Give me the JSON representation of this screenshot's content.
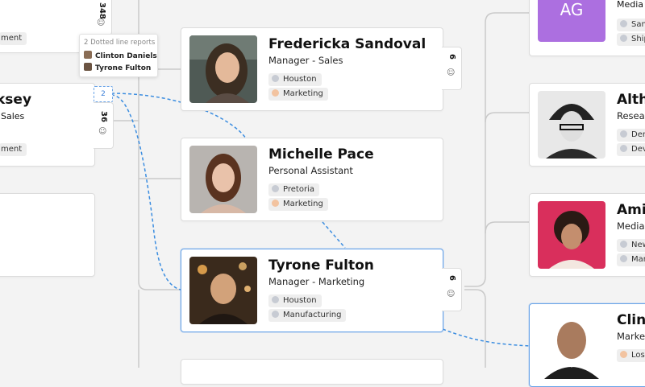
{
  "tooltip": {
    "header": "2 Dotted line reports",
    "rows": [
      "Clinton Daniels",
      "Tyrone Fulton"
    ]
  },
  "left_top": {
    "count": "348",
    "tag": "ment"
  },
  "left_mid": {
    "name": "ksey",
    "role": "Sales",
    "count": "36",
    "tag": "ment",
    "dotted_count": "2"
  },
  "cards": {
    "fredericka": {
      "name": "Fredericka Sandoval",
      "role": "Manager - Sales",
      "loc": "Houston",
      "dept": "Marketing",
      "count": "6"
    },
    "michelle": {
      "name": "Michelle Pace",
      "role": "Personal Assistant",
      "loc": "Pretoria",
      "dept": "Marketing"
    },
    "tyrone": {
      "name": "Tyrone Fulton",
      "role": "Manager - Marketing",
      "loc": "Houston",
      "dept": "Manufacturing",
      "count": "6"
    }
  },
  "right": {
    "ag": {
      "initials": "AG",
      "role": "Media",
      "tag1": "San",
      "tag2": "Ship"
    },
    "althea": {
      "name": "Alth",
      "role": "Resear",
      "tag1": "Den",
      "tag2": "Deve"
    },
    "amit": {
      "name": "Amit",
      "role": "Media",
      "tag1": "New",
      "tag2": "Man"
    },
    "clint": {
      "name": "Clint",
      "role": "Market",
      "tag1": "Los A"
    }
  },
  "colors": {
    "accent": "#6aa4e8",
    "ag_avatar": "#ac6fe0",
    "connector": "#c9c9c9"
  },
  "icons": {
    "people": "people-icon",
    "location": "location-dot-icon",
    "department": "department-dot-icon"
  }
}
